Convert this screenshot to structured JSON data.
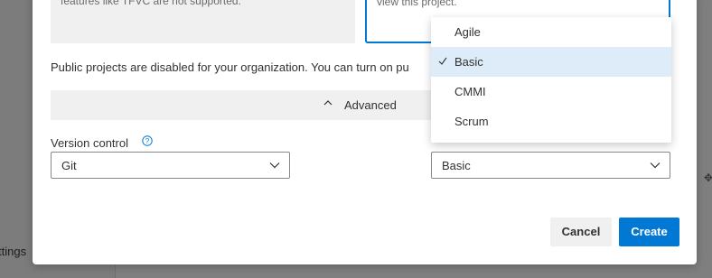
{
  "background": {
    "settings_label": "ttings"
  },
  "cards": {
    "left_text": "features like TFVC are not supported.",
    "right_text": "view this project."
  },
  "public_note": "Public projects are disabled for your organization. You can turn on pu",
  "advanced": {
    "label": "Advanced"
  },
  "version_control": {
    "label": "Version control",
    "value": "Git"
  },
  "process": {
    "value": "Basic",
    "options": [
      {
        "label": "Agile",
        "selected": false
      },
      {
        "label": "Basic",
        "selected": true
      },
      {
        "label": "CMMI",
        "selected": false
      },
      {
        "label": "Scrum",
        "selected": false
      }
    ]
  },
  "buttons": {
    "cancel": "Cancel",
    "create": "Create"
  },
  "colors": {
    "accent": "#0078d4",
    "selected_bg": "#deecf9",
    "panel_bg": "#f0f0f0"
  }
}
